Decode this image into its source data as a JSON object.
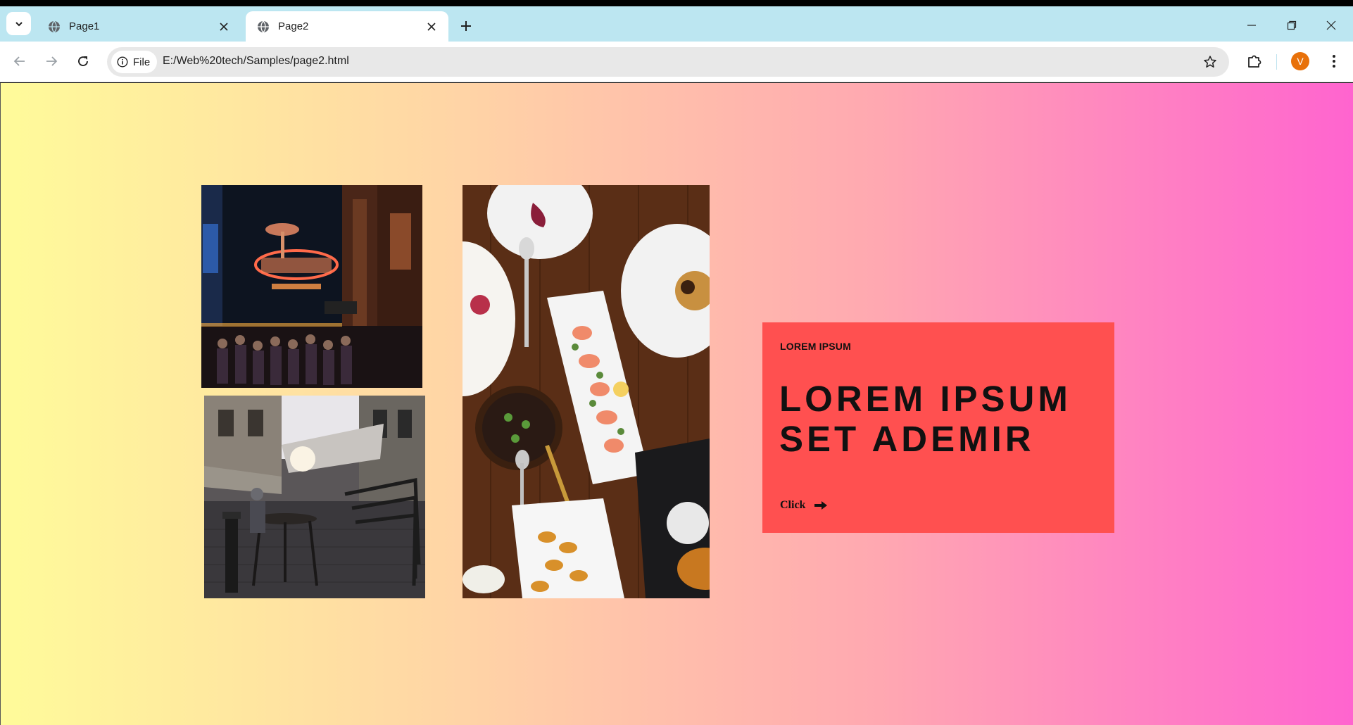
{
  "browser": {
    "tabs": [
      {
        "title": "Page1",
        "active": false
      },
      {
        "title": "Page2",
        "active": true
      }
    ],
    "address_bar": {
      "site_chip": "File",
      "url": "E:/Web%20tech/Samples/page2.html"
    },
    "profile_initial": "V",
    "colors": {
      "tabstrip": "#bce6f1",
      "avatar": "#e8710a"
    }
  },
  "page": {
    "images": [
      {
        "subject": "neon theatre sign on a busy night street"
      },
      {
        "subject": "narrow cobblestone street with cafe tables"
      },
      {
        "subject": "overhead view of plated dishes on a wooden table"
      }
    ],
    "card": {
      "eyebrow": "LOREM IPSUM",
      "heading": "LOREM IPSUM SET ADEMIR",
      "cta_label": "Click"
    },
    "colors": {
      "card": "#ff5050",
      "gradient_start": "#fffb9a",
      "gradient_end": "#ff64cf"
    }
  }
}
